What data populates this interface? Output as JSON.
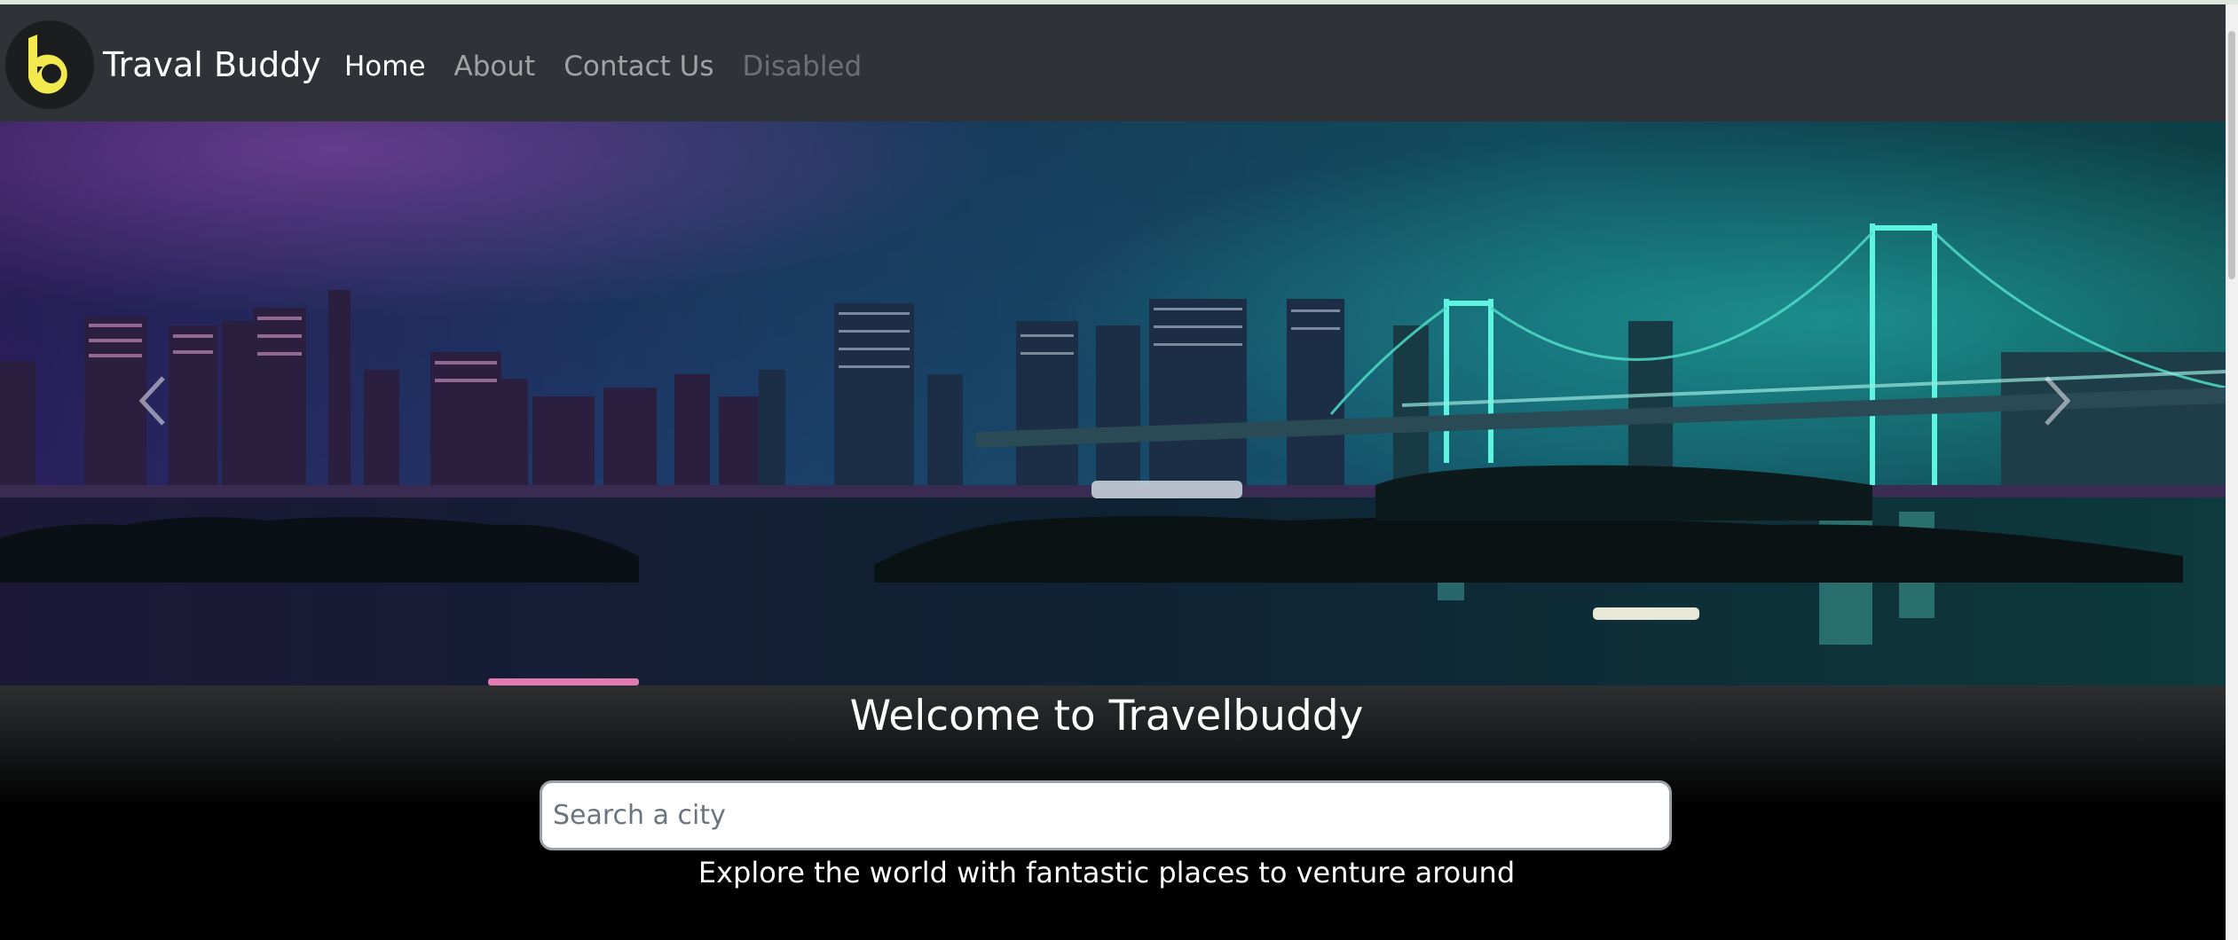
{
  "brand": {
    "name": "Traval Buddy",
    "logo_icon": "buddy-logo-icon"
  },
  "nav": {
    "home": "Home",
    "about": "About",
    "contact": "Contact Us",
    "disabled": "Disabled"
  },
  "carousel": {
    "prev_icon": "chevron-left-icon",
    "next_icon": "chevron-right-icon"
  },
  "hero": {
    "title": "Welcome to Travelbuddy",
    "search_placeholder": "Search a city",
    "tagline": "Explore the world with fantastic places to venture around"
  },
  "colors": {
    "navbar": "#2f3236",
    "logo_yellow": "#f2e94e",
    "bridge_teal": "#29d6c4"
  }
}
